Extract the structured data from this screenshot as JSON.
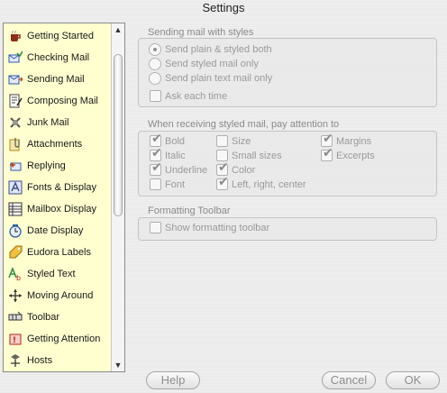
{
  "window": {
    "title": "Settings"
  },
  "sidebar": {
    "items": [
      {
        "label": "Getting Started",
        "icon": "coffee-cup-icon",
        "color": "#8b2e1a"
      },
      {
        "label": "Checking Mail",
        "icon": "mail-check-icon",
        "color": "#2a5db0"
      },
      {
        "label": "Sending Mail",
        "icon": "mail-send-icon",
        "color": "#2a5db0"
      },
      {
        "label": "Composing Mail",
        "icon": "compose-icon",
        "color": "#444444"
      },
      {
        "label": "Junk Mail",
        "icon": "junk-mail-icon",
        "color": "#555555"
      },
      {
        "label": "Attachments",
        "icon": "attachment-icon",
        "color": "#b08a20"
      },
      {
        "label": "Replying",
        "icon": "reply-icon",
        "color": "#c04a1a"
      },
      {
        "label": "Fonts & Display",
        "icon": "fonts-icon",
        "color": "#3a4a8a"
      },
      {
        "label": "Mailbox Display",
        "icon": "mailbox-icon",
        "color": "#333333"
      },
      {
        "label": "Date Display",
        "icon": "clock-icon",
        "color": "#2a5db0"
      },
      {
        "label": "Eudora Labels",
        "icon": "label-tag-icon",
        "color": "#d09a10"
      },
      {
        "label": "Styled Text",
        "icon": "styled-text-icon",
        "color": "#2a8a3a"
      },
      {
        "label": "Moving Around",
        "icon": "move-arrows-icon",
        "color": "#333333"
      },
      {
        "label": "Toolbar",
        "icon": "toolbar-icon",
        "color": "#333333"
      },
      {
        "label": "Getting Attention",
        "icon": "alarm-icon",
        "color": "#c02020"
      },
      {
        "label": "Hosts",
        "icon": "hosts-icon",
        "color": "#333333"
      }
    ],
    "scroll_up": "▲",
    "scroll_down": "▼"
  },
  "sending": {
    "title": "Sending mail with styles",
    "options": [
      {
        "label": "Send plain & styled both",
        "selected": true
      },
      {
        "label": "Send styled mail only",
        "selected": false
      },
      {
        "label": "Send plain text mail only",
        "selected": false
      }
    ],
    "ask_each_time": {
      "label": "Ask each time",
      "checked": false
    }
  },
  "receiving": {
    "title": "When receiving styled mail, pay attention to",
    "options": [
      {
        "label": "Bold",
        "checked": true
      },
      {
        "label": "Italic",
        "checked": true
      },
      {
        "label": "Underline",
        "checked": true
      },
      {
        "label": "Font",
        "checked": false
      },
      {
        "label": "Size",
        "checked": false
      },
      {
        "label": "Small sizes",
        "checked": false
      },
      {
        "label": "Color",
        "checked": true
      },
      {
        "label": "Left, right, center",
        "checked": true
      },
      {
        "label": "Margins",
        "checked": true
      },
      {
        "label": "Excerpts",
        "checked": true
      }
    ]
  },
  "formatting": {
    "title": "Formatting Toolbar",
    "show_toolbar": {
      "label": "Show formatting toolbar",
      "checked": false
    }
  },
  "buttons": {
    "help": "Help",
    "cancel": "Cancel",
    "ok": "OK"
  }
}
